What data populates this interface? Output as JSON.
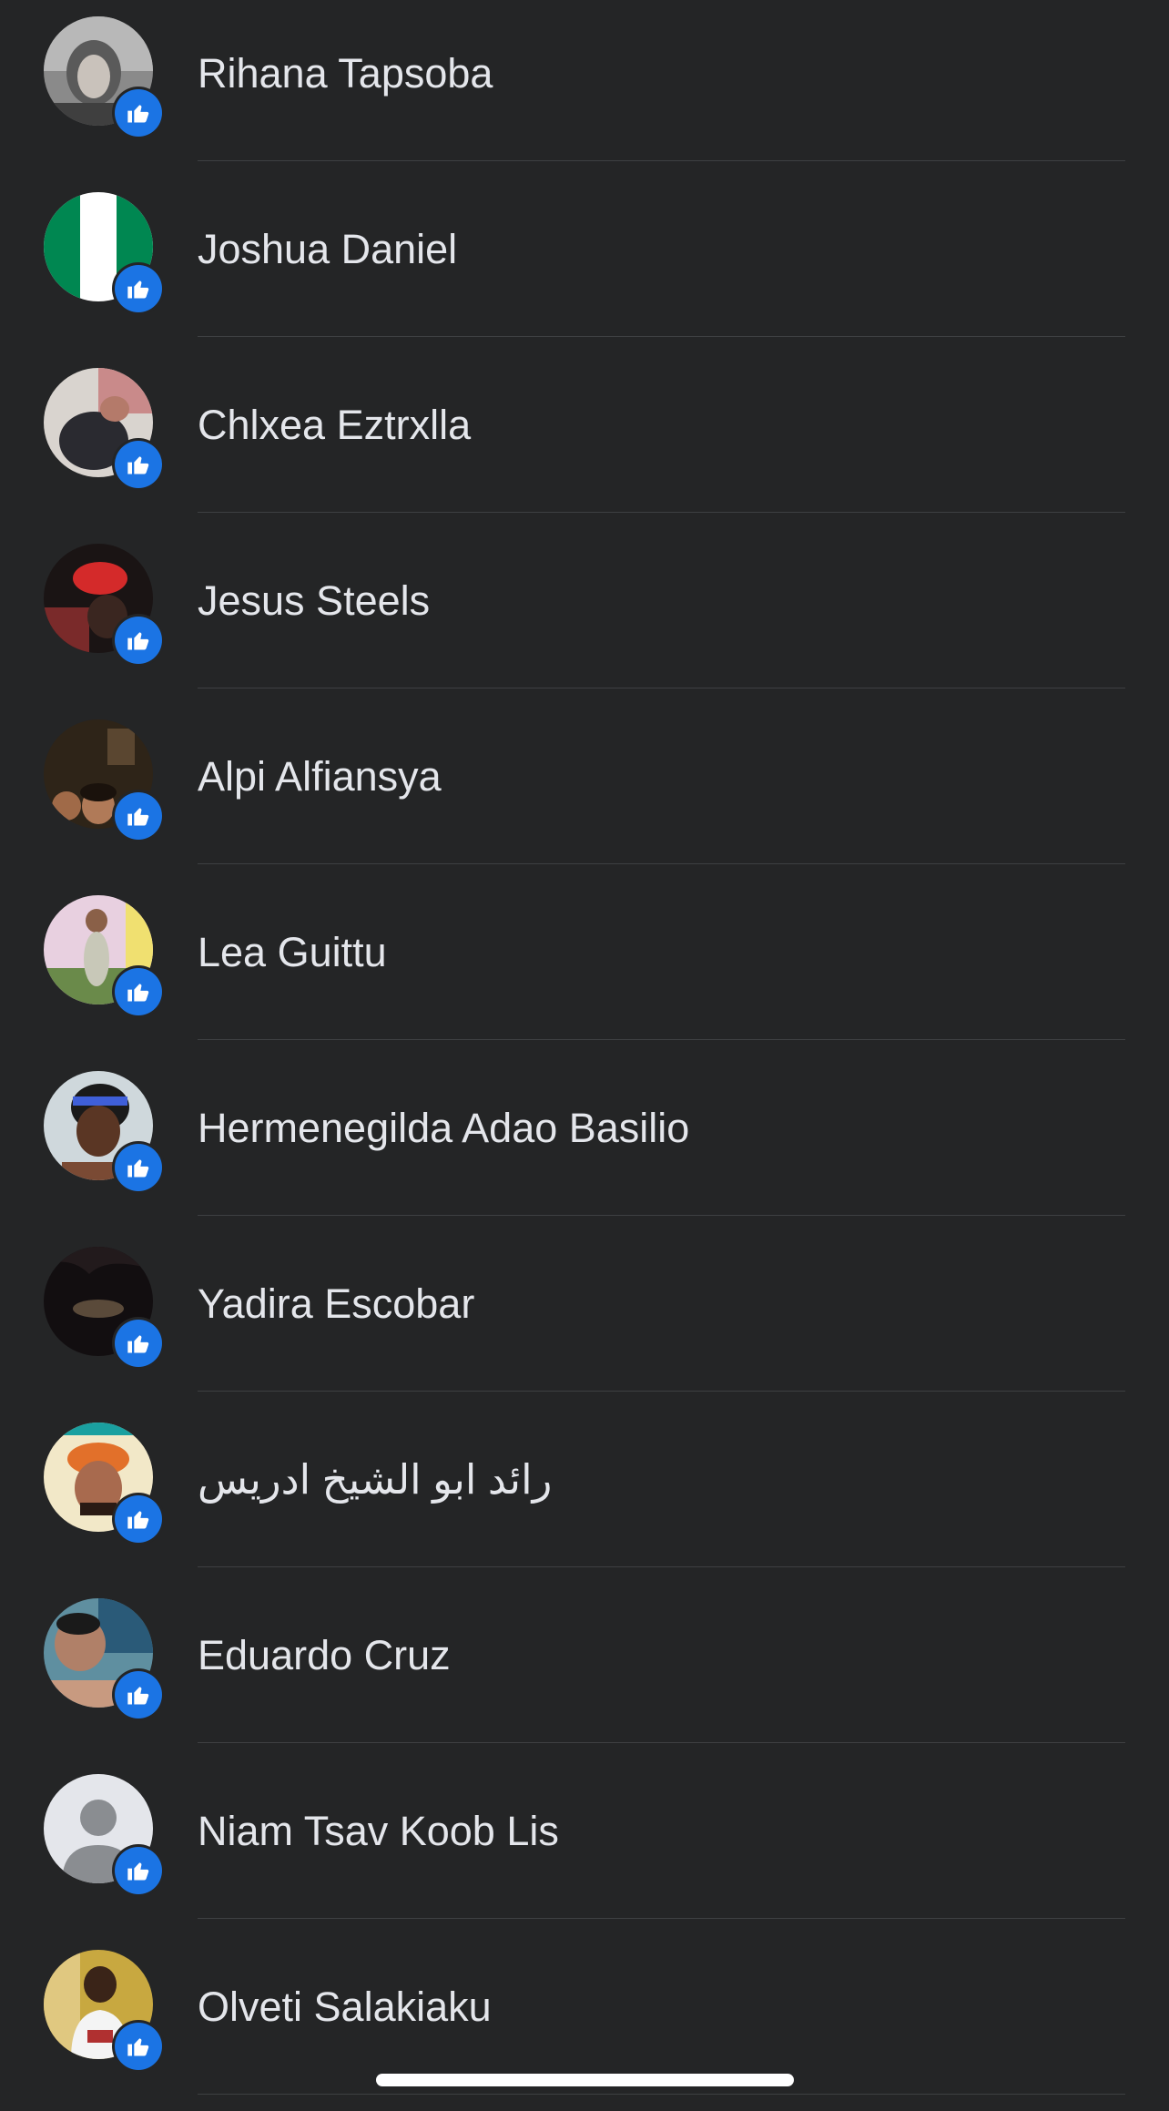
{
  "colors": {
    "background": "#242526",
    "text": "#e4e6eb",
    "divider": "#3e4042",
    "like_badge": "#1b74e4"
  },
  "reactions": [
    {
      "name": "Rihana Tapsoba",
      "avatar": "photo-grey-portrait",
      "reaction_icon": "thumbs-up-icon"
    },
    {
      "name": "Joshua Daniel",
      "avatar": "nigeria-flag",
      "reaction_icon": "thumbs-up-icon"
    },
    {
      "name": "Chlxea Eztrxlla",
      "avatar": "photo-mirror-selfie",
      "reaction_icon": "thumbs-up-icon"
    },
    {
      "name": "Jesus Steels",
      "avatar": "photo-red-cap",
      "reaction_icon": "thumbs-up-icon"
    },
    {
      "name": "Alpi Alfiansya",
      "avatar": "photo-group-indoor",
      "reaction_icon": "thumbs-up-icon"
    },
    {
      "name": "Lea Guittu",
      "avatar": "photo-child-outdoor",
      "reaction_icon": "thumbs-up-icon"
    },
    {
      "name": "Hermenegilda Adao Basilio",
      "avatar": "photo-smiling-headband",
      "reaction_icon": "thumbs-up-icon"
    },
    {
      "name": "Yadira Escobar",
      "avatar": "photo-night-sky",
      "reaction_icon": "thumbs-up-icon"
    },
    {
      "name": "رائد ابو الشيخ ادريس",
      "avatar": "photo-orange-cap",
      "reaction_icon": "thumbs-up-icon"
    },
    {
      "name": "Eduardo Cruz",
      "avatar": "photo-pool-selfie",
      "reaction_icon": "thumbs-up-icon"
    },
    {
      "name": "Niam Tsav Koob Lis",
      "avatar": "default-silhouette",
      "reaction_icon": "thumbs-up-icon"
    },
    {
      "name": "Olveti Salakiaku",
      "avatar": "photo-jersey-22",
      "reaction_icon": "thumbs-up-icon"
    }
  ]
}
